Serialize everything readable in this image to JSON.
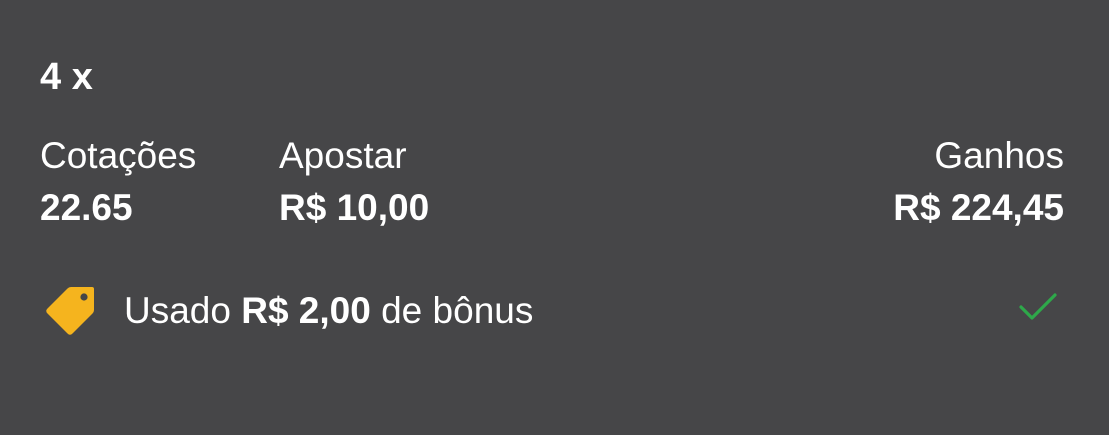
{
  "bet": {
    "multiplier": "4 x"
  },
  "summary": {
    "odds_label": "Cotações",
    "odds_value": "22.65",
    "stake_label": "Apostar",
    "stake_value": "R$ 10,00",
    "winnings_label": "Ganhos",
    "winnings_value": "R$ 224,45"
  },
  "bonus": {
    "prefix": "Usado",
    "amount": "R$ 2,00",
    "suffix": "de bônus",
    "tag_icon": "tag-icon",
    "status_icon": "checkmark-icon",
    "tag_color": "#F5B41E",
    "check_color": "#2EA84A"
  },
  "colors": {
    "background": "#464648",
    "text": "#FFFFFF"
  }
}
